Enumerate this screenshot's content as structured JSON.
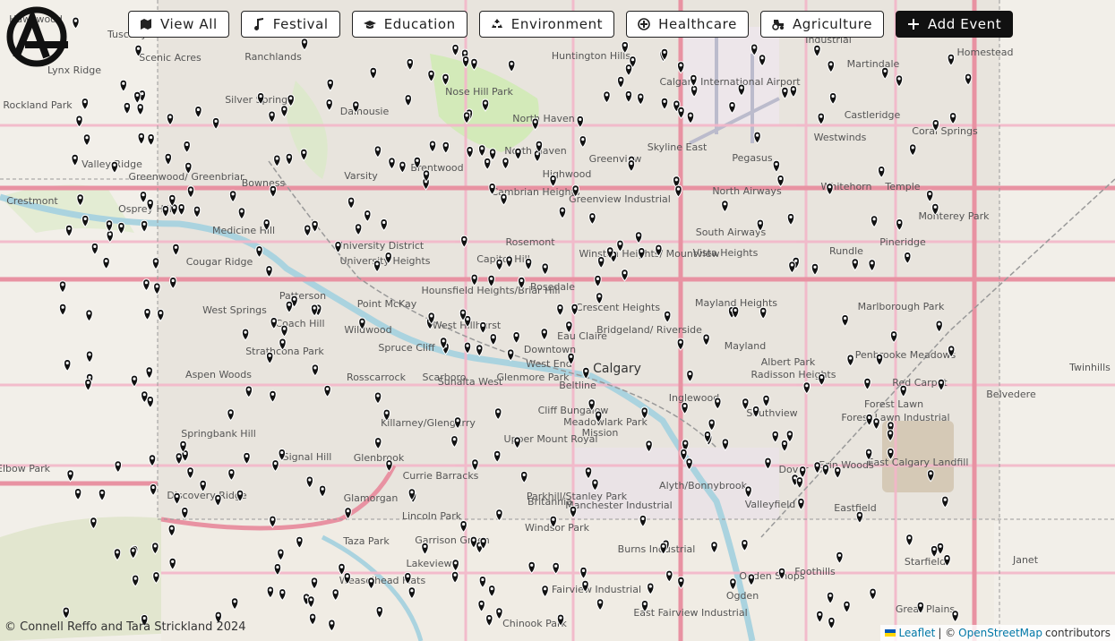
{
  "toolbar": {
    "view_all": "View All",
    "festival": "Festival",
    "education": "Education",
    "environment": "Environment",
    "healthcare": "Healthcare",
    "agriculture": "Agriculture",
    "add_event": "Add Event"
  },
  "footer": {
    "credit": "© Connell Reffo and Tara Strickland 2024",
    "leaflet": "Leaflet",
    "sep": "| ©",
    "osm": "OpenStreetMap",
    "contributors": "contributors"
  },
  "map": {
    "city_label": "Calgary",
    "labels": [
      "Hawkwood",
      "Scenic Acres",
      "Ranchlands",
      "Huntington Hills",
      "Calgary International Airport",
      "Industrial",
      "Homestead",
      "Lynx Ridge",
      "Tuscany",
      "Rockland Park",
      "Silver Springs",
      "Dalhousie",
      "Nose Hill Park",
      "North Haven",
      "Skyline East",
      "Martindale",
      "Castleridge",
      "Westwinds",
      "Coral Springs",
      "North Haven",
      "Greenview",
      "Pegasus",
      "Valley Ridge",
      "Greenwood/ Greenbriar",
      "Bowness",
      "Brentwood",
      "Varsity",
      "Highwood",
      "Cambrian Heights",
      "Greenview Industrial",
      "North Airways",
      "Whitehorn",
      "Temple",
      "Crestmont",
      "Osprey Hill",
      "Medicine Hill",
      "Cougar Ridge",
      "University District",
      "University Heights",
      "Capitol Hill",
      "Rosemont",
      "Winston Heights/ Mountview",
      "South Airways",
      "Vista Heights",
      "Monterey Park",
      "Pineridge",
      "Rundle",
      "Patterson",
      "Point McKay",
      "Hounsfield Heights/Briar Hill",
      "Rosedale",
      "Crescent Heights",
      "Mayland Heights",
      "Marlborough Park",
      "West Springs",
      "Coach Hill",
      "Wildwood",
      "West Hillhurst",
      "Bridgeland/ Riverside",
      "Spruce Cliff",
      "Downtown",
      "Eau Claire",
      "Mayland",
      "Albert Park",
      "Penbrooke Meadows",
      "Strathcona Park",
      "Aspen Woods",
      "Rosscarrock",
      "West End",
      "Scarboro",
      "Sunalta West",
      "Beltline",
      "Inglewood",
      "Radisson Heights",
      "Red Carpet",
      "Twinhills",
      "Belvedere",
      "Killarney/Glengarry",
      "Cliff Bungalow",
      "Upper Mount Royal",
      "Forest Lawn",
      "Forest Lawn Industrial",
      "Springbank Hill",
      "Signal Hill",
      "Glenbrook",
      "Southview",
      "Erin Woods",
      "East Calgary Landfill",
      "Currie Barracks",
      "Parkhill/Stanley Park",
      "Dover",
      "Alyth/Bonnybrook",
      "Discovery Ridge",
      "Glamorgan",
      "Lincoln Park",
      "Britannia",
      "Manchester Industrial",
      "Valleyfield",
      "Eastfield",
      "Taza Park",
      "Garrison Green",
      "Windsor Park",
      "Lakeview",
      "Burns Industrial",
      "Foothills",
      "Starfield",
      "Janet",
      "Elbow Park",
      "Mission",
      "Fairview Industrial",
      "Ogden Shops",
      "Weaselhead Flats",
      "Chinook Park",
      "East Fairview Industrial",
      "Ogden",
      "Great Plains",
      "Glenmore Park",
      "Meadowlark Park"
    ]
  },
  "colors": {
    "marker": "#111111",
    "land": "#f2efe9",
    "road_major": "#f3b6c9",
    "road_highway": "#e892a2",
    "water": "#aad3df",
    "park": "#cdebb0",
    "industrial": "#e6d6e6",
    "river": "#9dcfe0"
  },
  "icons": {
    "view_all": "map-icon",
    "festival": "music-note-icon",
    "education": "graduation-cap-icon",
    "environment": "recycle-icon",
    "healthcare": "medical-icon",
    "agriculture": "tractor-icon",
    "add_event": "plus-icon",
    "markers": "map-pin-icon",
    "logo": "site-logo"
  }
}
